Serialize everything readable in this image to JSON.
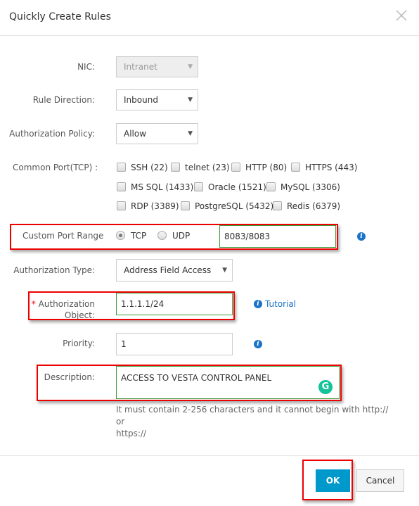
{
  "dialog": {
    "title": "Quickly Create Rules",
    "close_icon": "close-x-icon"
  },
  "form": {
    "nic": {
      "label": "NIC:",
      "value": "Intranet",
      "disabled": true
    },
    "rule_direction": {
      "label": "Rule Direction:",
      "value": "Inbound"
    },
    "authorization_policy": {
      "label": "Authorization Policy:",
      "value": "Allow"
    },
    "common_port": {
      "label": "Common Port(TCP) :",
      "options": [
        {
          "label": "SSH (22)",
          "checked": false
        },
        {
          "label": "telnet (23)",
          "checked": false
        },
        {
          "label": "HTTP (80)",
          "checked": false
        },
        {
          "label": "HTTPS (443)",
          "checked": false
        },
        {
          "label": "MS SQL (1433)",
          "checked": false
        },
        {
          "label": "Oracle (1521)",
          "checked": false
        },
        {
          "label": "MySQL (3306)",
          "checked": false
        },
        {
          "label": "RDP (3389)",
          "checked": false
        },
        {
          "label": "PostgreSQL (5432)",
          "checked": false
        },
        {
          "label": "Redis (6379)",
          "checked": false
        }
      ]
    },
    "custom_port_range": {
      "label": "Custom Port Range",
      "protocols": [
        {
          "label": "TCP",
          "selected": true
        },
        {
          "label": "UDP",
          "selected": false
        }
      ],
      "value": "8083/8083",
      "info_icon": "info-icon"
    },
    "authorization_type": {
      "label": "Authorization Type:",
      "value": "Address Field Access"
    },
    "authorization_object": {
      "required_mark": "*",
      "label_line1": "Authorization",
      "label_line2": "Object:",
      "value": "1.1.1.1/24",
      "tutorial_link": "Tutorial"
    },
    "priority": {
      "label": "Priority:",
      "value": "1"
    },
    "description": {
      "label": "Description:",
      "value": "ACCESS TO VESTA CONTROL PANEL",
      "hint_line1": "It must contain 2-256 characters and it cannot begin with http:// or",
      "hint_line2": "https://",
      "grammarly_glyph": "G"
    }
  },
  "footer": {
    "ok_label": "OK",
    "cancel_label": "Cancel"
  },
  "colors": {
    "primary": "#0099cc",
    "highlight_box": "#ee0000",
    "valid_border": "#3c9a3c",
    "link": "#1a73c8"
  }
}
